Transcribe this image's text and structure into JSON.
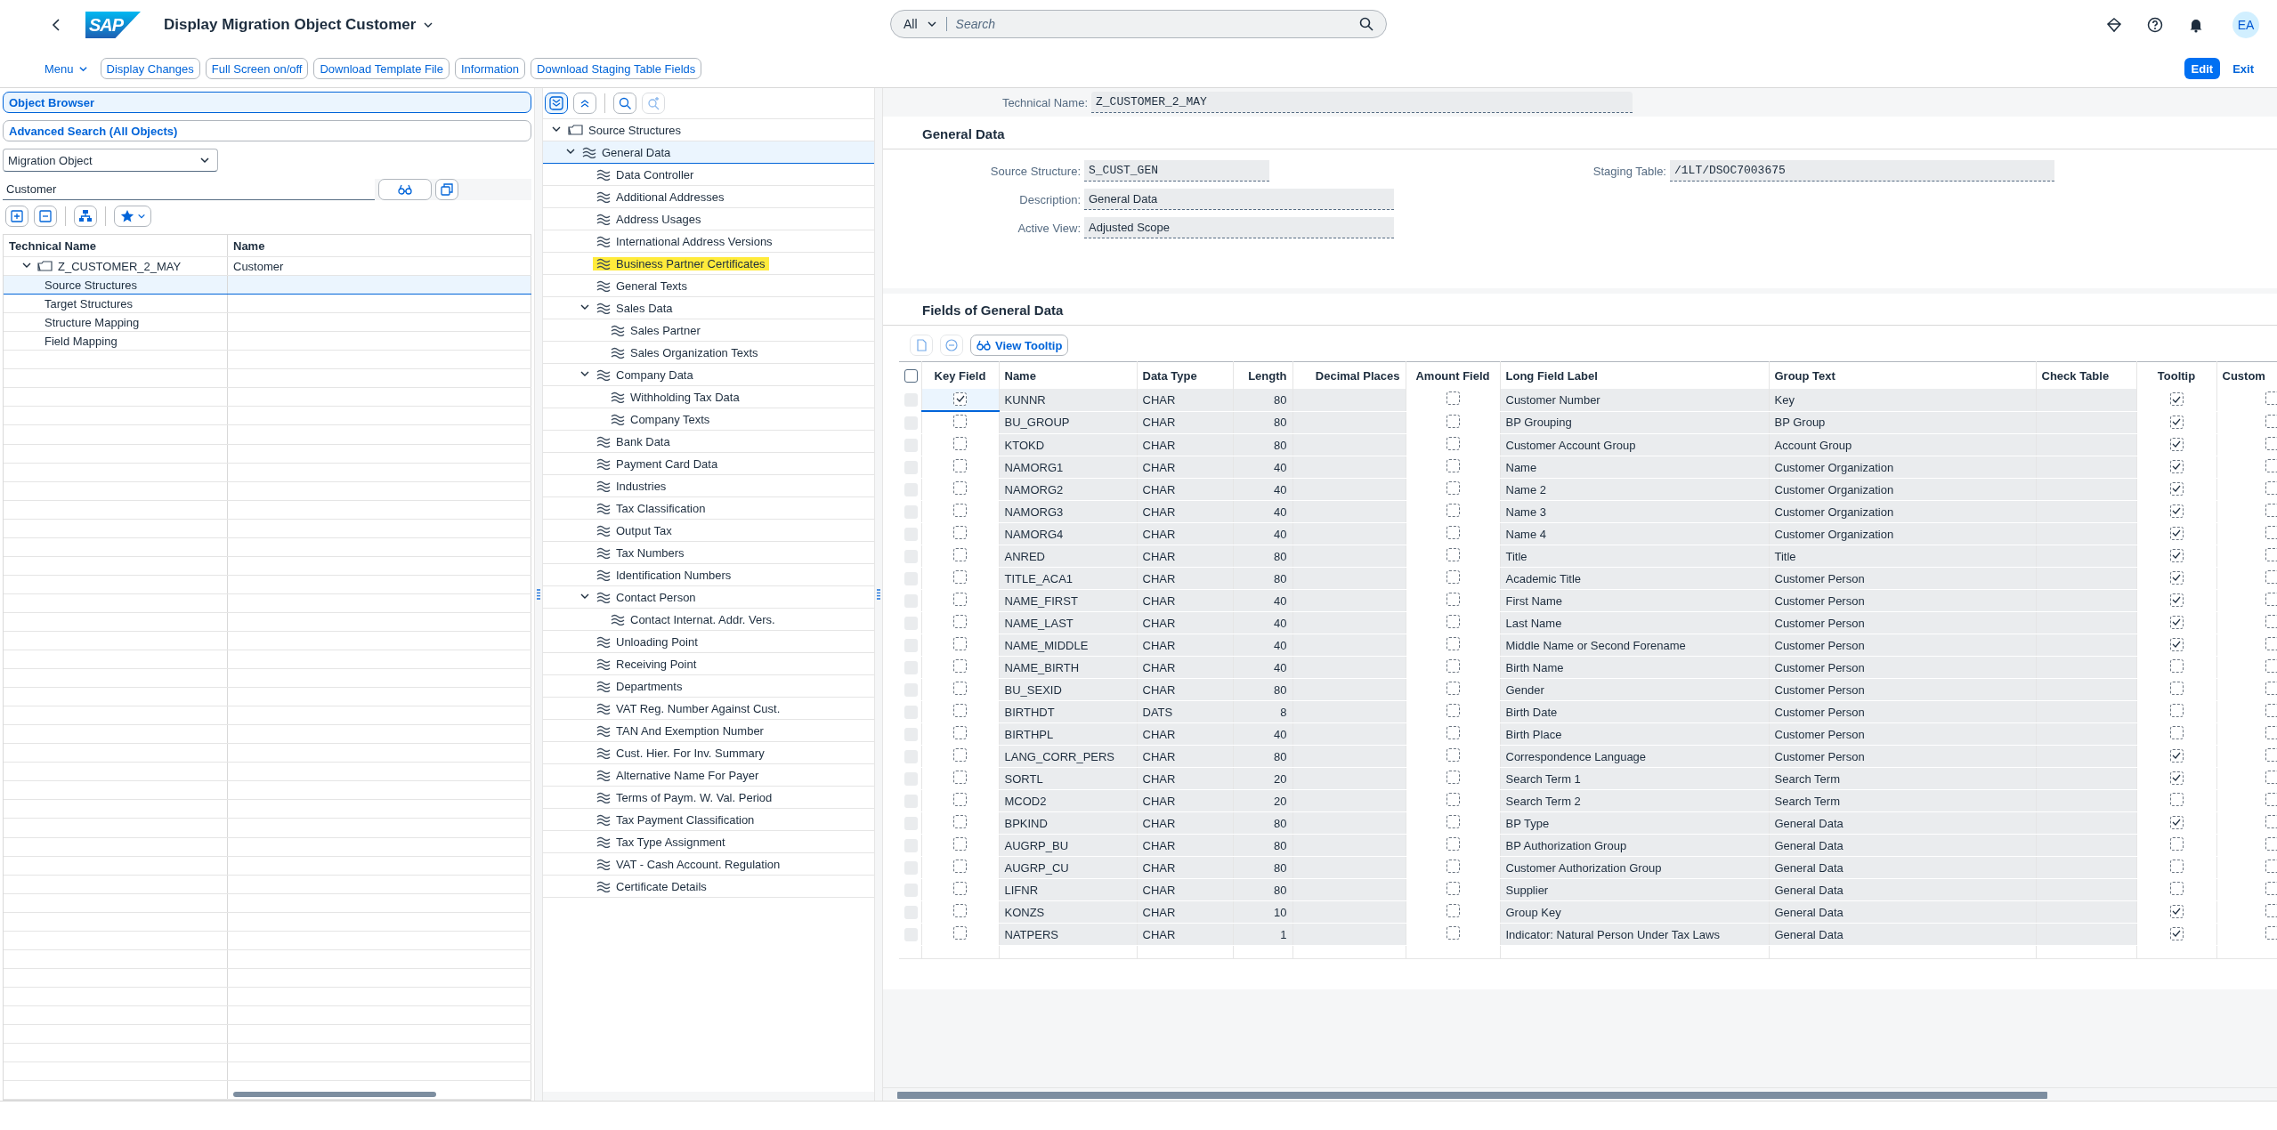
{
  "shell": {
    "logo": "SAP",
    "title": "Display Migration Object Customer",
    "search": {
      "scope": "All",
      "placeholder": "Search"
    },
    "avatar": "EA"
  },
  "toolbar": {
    "menu": "Menu",
    "buttons": [
      "Display Changes",
      "Full Screen on/off",
      "Download Template File",
      "Information",
      "Download Staging Table Fields"
    ],
    "actions": [
      {
        "label": "Edit",
        "kind": "emphasized"
      },
      {
        "label": "Exit",
        "kind": "transparent"
      }
    ]
  },
  "object_browser": {
    "tabs": [
      {
        "label": "Object Browser",
        "selected": true
      },
      {
        "label": "Advanced Search (All Objects)",
        "selected": false
      }
    ],
    "search_type": "Migration Object",
    "search_value": "Customer",
    "table": {
      "columns": [
        "Technical Name",
        "Name"
      ],
      "rows": [
        {
          "technical_name": "Z_CUSTOMER_2_MAY",
          "name": "Customer",
          "expanded": true,
          "selected": false,
          "children": [
            {
              "technical_name": "Source Structures",
              "selected": true
            },
            {
              "technical_name": "Target Structures",
              "selected": false
            },
            {
              "technical_name": "Structure Mapping",
              "selected": false
            },
            {
              "technical_name": "Field Mapping",
              "selected": false
            }
          ]
        }
      ]
    }
  },
  "structure_tree": {
    "nodes": [
      {
        "label": "Source Structures",
        "kind": "folder",
        "expanded": true,
        "selected": false,
        "highlighted": false,
        "children": [
          {
            "label": "General Data",
            "kind": "structure",
            "expanded": true,
            "selected": true,
            "highlighted": false,
            "children": [
              {
                "label": "Data Controller",
                "kind": "structure",
                "selected": false,
                "highlighted": false
              },
              {
                "label": "Additional Addresses",
                "kind": "structure",
                "selected": false,
                "highlighted": false
              },
              {
                "label": "Address Usages",
                "kind": "structure",
                "selected": false,
                "highlighted": false
              },
              {
                "label": "International Address Versions",
                "kind": "structure",
                "selected": false,
                "highlighted": false
              },
              {
                "label": "Business Partner Certificates",
                "kind": "structure",
                "selected": false,
                "highlighted": true
              },
              {
                "label": "General Texts",
                "kind": "structure",
                "selected": false,
                "highlighted": false
              },
              {
                "label": "Sales Data",
                "kind": "structure",
                "expanded": true,
                "selected": false,
                "highlighted": false,
                "children": [
                  {
                    "label": "Sales Partner",
                    "kind": "structure",
                    "selected": false,
                    "highlighted": false
                  },
                  {
                    "label": "Sales Organization Texts",
                    "kind": "structure",
                    "selected": false,
                    "highlighted": false
                  }
                ]
              },
              {
                "label": "Company Data",
                "kind": "structure",
                "expanded": true,
                "selected": false,
                "highlighted": false,
                "children": [
                  {
                    "label": "Withholding Tax Data",
                    "kind": "structure",
                    "selected": false,
                    "highlighted": false
                  },
                  {
                    "label": "Company Texts",
                    "kind": "structure",
                    "selected": false,
                    "highlighted": false
                  }
                ]
              },
              {
                "label": "Bank Data",
                "kind": "structure",
                "selected": false,
                "highlighted": false
              },
              {
                "label": "Payment Card Data",
                "kind": "structure",
                "selected": false,
                "highlighted": false
              },
              {
                "label": "Industries",
                "kind": "structure",
                "selected": false,
                "highlighted": false
              },
              {
                "label": "Tax Classification",
                "kind": "structure",
                "selected": false,
                "highlighted": false
              },
              {
                "label": "Output Tax",
                "kind": "structure",
                "selected": false,
                "highlighted": false
              },
              {
                "label": "Tax Numbers",
                "kind": "structure",
                "selected": false,
                "highlighted": false
              },
              {
                "label": "Identification Numbers",
                "kind": "structure",
                "selected": false,
                "highlighted": false
              },
              {
                "label": "Contact Person",
                "kind": "structure",
                "expanded": true,
                "selected": false,
                "highlighted": false,
                "children": [
                  {
                    "label": "Contact Internat. Addr. Vers.",
                    "kind": "structure",
                    "selected": false,
                    "highlighted": false
                  }
                ]
              },
              {
                "label": "Unloading Point",
                "kind": "structure",
                "selected": false,
                "highlighted": false
              },
              {
                "label": "Receiving Point",
                "kind": "structure",
                "selected": false,
                "highlighted": false
              },
              {
                "label": "Departments",
                "kind": "structure",
                "selected": false,
                "highlighted": false
              },
              {
                "label": "VAT Reg. Number Against Cust.",
                "kind": "structure",
                "selected": false,
                "highlighted": false
              },
              {
                "label": "TAN And Exemption Number",
                "kind": "structure",
                "selected": false,
                "highlighted": false
              },
              {
                "label": "Cust. Hier. For Inv. Summary",
                "kind": "structure",
                "selected": false,
                "highlighted": false
              },
              {
                "label": "Alternative Name For Payer",
                "kind": "structure",
                "selected": false,
                "highlighted": false
              },
              {
                "label": "Terms of Paym. W. Val. Period",
                "kind": "structure",
                "selected": false,
                "highlighted": false
              },
              {
                "label": "Tax Payment Classification",
                "kind": "structure",
                "selected": false,
                "highlighted": false
              },
              {
                "label": "Tax Type Assignment",
                "kind": "structure",
                "selected": false,
                "highlighted": false
              },
              {
                "label": "VAT - Cash Account. Regulation",
                "kind": "structure",
                "selected": false,
                "highlighted": false
              },
              {
                "label": "Certificate Details",
                "kind": "structure",
                "selected": false,
                "highlighted": false
              }
            ]
          }
        ]
      }
    ]
  },
  "technical_name": {
    "label": "Technical Name:",
    "value": "Z_CUSTOMER_2_MAY"
  },
  "general_data": {
    "title": "General Data",
    "left_fields": [
      {
        "label": "Source Structure:",
        "value": "S_CUST_GEN",
        "kind": "code"
      },
      {
        "label": "Description:",
        "value": "General Data",
        "kind": "text"
      },
      {
        "label": "Active View:",
        "value": "Adjusted Scope",
        "kind": "text"
      }
    ],
    "right_fields": [
      {
        "label": "Staging Table:",
        "value": "/1LT/DSOC7003675",
        "kind": "code"
      }
    ]
  },
  "fields_table": {
    "title": "Fields of General Data",
    "view_tooltip": "View Tooltip",
    "select_all": false,
    "columns": [
      "Key Field",
      "Name",
      "Data Type",
      "Length",
      "Decimal Places",
      "Amount Field",
      "Long Field Label",
      "Group Text",
      "Check Table",
      "Tooltip",
      "Custom"
    ],
    "rows": [
      {
        "key_field": true,
        "name": "KUNNR",
        "data_type": "CHAR",
        "length": "80",
        "amount_field": false,
        "long_label": "Customer Number",
        "group_text": "Key",
        "tooltip": true,
        "custom": false
      },
      {
        "key_field": false,
        "name": "BU_GROUP",
        "data_type": "CHAR",
        "length": "80",
        "amount_field": false,
        "long_label": "BP Grouping",
        "group_text": "BP Group",
        "tooltip": true,
        "custom": false
      },
      {
        "key_field": false,
        "name": "KTOKD",
        "data_type": "CHAR",
        "length": "80",
        "amount_field": false,
        "long_label": "Customer Account Group",
        "group_text": "Account Group",
        "tooltip": true,
        "custom": false
      },
      {
        "key_field": false,
        "name": "NAMORG1",
        "data_type": "CHAR",
        "length": "40",
        "amount_field": false,
        "long_label": "Name",
        "group_text": "Customer Organization",
        "tooltip": true,
        "custom": false
      },
      {
        "key_field": false,
        "name": "NAMORG2",
        "data_type": "CHAR",
        "length": "40",
        "amount_field": false,
        "long_label": "Name 2",
        "group_text": "Customer Organization",
        "tooltip": true,
        "custom": false
      },
      {
        "key_field": false,
        "name": "NAMORG3",
        "data_type": "CHAR",
        "length": "40",
        "amount_field": false,
        "long_label": "Name 3",
        "group_text": "Customer Organization",
        "tooltip": true,
        "custom": false
      },
      {
        "key_field": false,
        "name": "NAMORG4",
        "data_type": "CHAR",
        "length": "40",
        "amount_field": false,
        "long_label": "Name 4",
        "group_text": "Customer Organization",
        "tooltip": true,
        "custom": false
      },
      {
        "key_field": false,
        "name": "ANRED",
        "data_type": "CHAR",
        "length": "80",
        "amount_field": false,
        "long_label": "Title",
        "group_text": "Title",
        "tooltip": true,
        "custom": false
      },
      {
        "key_field": false,
        "name": "TITLE_ACA1",
        "data_type": "CHAR",
        "length": "80",
        "amount_field": false,
        "long_label": "Academic Title",
        "group_text": "Customer Person",
        "tooltip": true,
        "custom": false
      },
      {
        "key_field": false,
        "name": "NAME_FIRST",
        "data_type": "CHAR",
        "length": "40",
        "amount_field": false,
        "long_label": "First Name",
        "group_text": "Customer Person",
        "tooltip": true,
        "custom": false
      },
      {
        "key_field": false,
        "name": "NAME_LAST",
        "data_type": "CHAR",
        "length": "40",
        "amount_field": false,
        "long_label": "Last Name",
        "group_text": "Customer Person",
        "tooltip": true,
        "custom": false
      },
      {
        "key_field": false,
        "name": "NAME_MIDDLE",
        "data_type": "CHAR",
        "length": "40",
        "amount_field": false,
        "long_label": "Middle Name or Second Forename",
        "group_text": "Customer Person",
        "tooltip": true,
        "custom": false
      },
      {
        "key_field": false,
        "name": "NAME_BIRTH",
        "data_type": "CHAR",
        "length": "40",
        "amount_field": false,
        "long_label": "Birth Name",
        "group_text": "Customer Person",
        "tooltip": false,
        "custom": false
      },
      {
        "key_field": false,
        "name": "BU_SEXID",
        "data_type": "CHAR",
        "length": "80",
        "amount_field": false,
        "long_label": "Gender",
        "group_text": "Customer Person",
        "tooltip": false,
        "custom": false
      },
      {
        "key_field": false,
        "name": "BIRTHDT",
        "data_type": "DATS",
        "length": "8",
        "amount_field": false,
        "long_label": "Birth Date",
        "group_text": "Customer Person",
        "tooltip": false,
        "custom": false
      },
      {
        "key_field": false,
        "name": "BIRTHPL",
        "data_type": "CHAR",
        "length": "40",
        "amount_field": false,
        "long_label": "Birth Place",
        "group_text": "Customer Person",
        "tooltip": false,
        "custom": false
      },
      {
        "key_field": false,
        "name": "LANG_CORR_PERS",
        "data_type": "CHAR",
        "length": "80",
        "amount_field": false,
        "long_label": "Correspondence Language",
        "group_text": "Customer Person",
        "tooltip": true,
        "custom": false
      },
      {
        "key_field": false,
        "name": "SORTL",
        "data_type": "CHAR",
        "length": "20",
        "amount_field": false,
        "long_label": "Search Term 1",
        "group_text": "Search Term",
        "tooltip": true,
        "custom": false
      },
      {
        "key_field": false,
        "name": "MCOD2",
        "data_type": "CHAR",
        "length": "20",
        "amount_field": false,
        "long_label": "Search Term 2",
        "group_text": "Search Term",
        "tooltip": false,
        "custom": false
      },
      {
        "key_field": false,
        "name": "BPKIND",
        "data_type": "CHAR",
        "length": "80",
        "amount_field": false,
        "long_label": "BP Type",
        "group_text": "General Data",
        "tooltip": true,
        "custom": false
      },
      {
        "key_field": false,
        "name": "AUGRP_BU",
        "data_type": "CHAR",
        "length": "80",
        "amount_field": false,
        "long_label": "BP Authorization Group",
        "group_text": "General Data",
        "tooltip": false,
        "custom": false
      },
      {
        "key_field": false,
        "name": "AUGRP_CU",
        "data_type": "CHAR",
        "length": "80",
        "amount_field": false,
        "long_label": "Customer Authorization Group",
        "group_text": "General Data",
        "tooltip": false,
        "custom": false
      },
      {
        "key_field": false,
        "name": "LIFNR",
        "data_type": "CHAR",
        "length": "80",
        "amount_field": false,
        "long_label": "Supplier",
        "group_text": "General Data",
        "tooltip": false,
        "custom": false
      },
      {
        "key_field": false,
        "name": "KONZS",
        "data_type": "CHAR",
        "length": "10",
        "amount_field": false,
        "long_label": "Group Key",
        "group_text": "General Data",
        "tooltip": true,
        "custom": false
      },
      {
        "key_field": false,
        "name": "NATPERS",
        "data_type": "CHAR",
        "length": "1",
        "amount_field": false,
        "long_label": "Indicator: Natural Person Under Tax Laws",
        "group_text": "General Data",
        "tooltip": true,
        "custom": false
      }
    ]
  }
}
